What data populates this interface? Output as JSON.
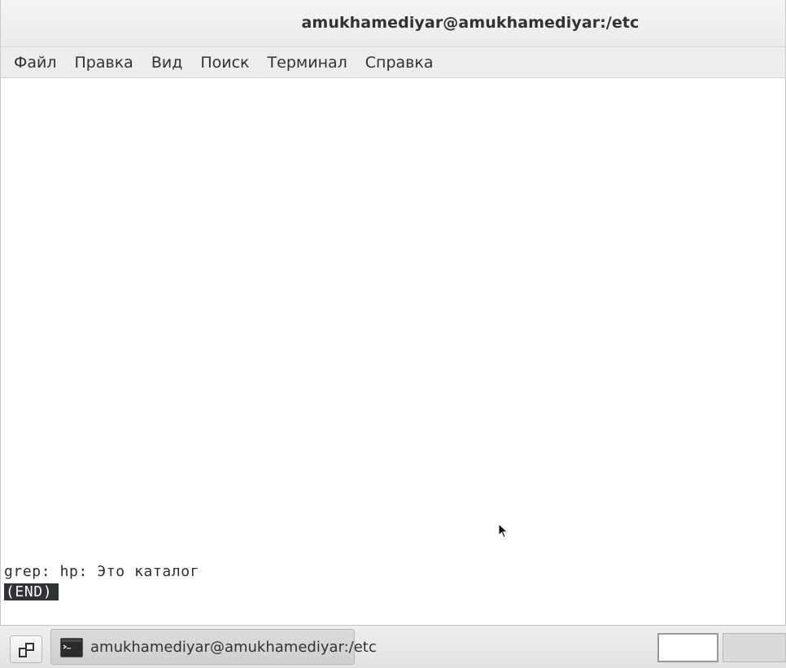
{
  "window": {
    "title": "amukhamediyar@amukhamediyar:/etc"
  },
  "menubar": {
    "items": [
      {
        "label": "Файл"
      },
      {
        "label": "Правка"
      },
      {
        "label": "Вид"
      },
      {
        "label": "Поиск"
      },
      {
        "label": "Терминал"
      },
      {
        "label": "Справка"
      }
    ]
  },
  "terminal": {
    "lines": [
      "grep: hp: Это каталог"
    ],
    "pager_status": "(END)"
  },
  "taskbar": {
    "task_label": "amukhamediyar@amukhamediyar:/etc",
    "show_desktop_icon": "show-desktop-icon",
    "terminal_icon": "terminal-icon"
  }
}
